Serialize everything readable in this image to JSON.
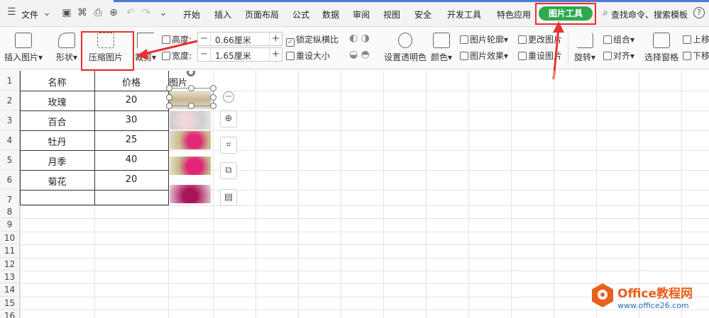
{
  "menu": {
    "label": "文件",
    "items": [
      "开始",
      "插入",
      "页面布局",
      "公式",
      "数据",
      "审阅",
      "视图",
      "安全",
      "开发工具",
      "特色应用"
    ],
    "active": "图片工具",
    "search": "查找命令、搜索模板",
    "help": "?"
  },
  "ribbon": {
    "insert_pic": "插入图片",
    "shape": "形状",
    "compress": "压缩图片",
    "crop": "裁剪",
    "height_label": "高度:",
    "height_value": "0.66厘米",
    "width_label": "宽度:",
    "width_value": "1.65厘米",
    "lock_ratio": "锁定纵横比",
    "reset_size": "重设大小",
    "transparent": "设置透明色",
    "color": "颜色",
    "pic_outline": "图片轮廓",
    "pic_effect": "图片效果",
    "change_pic": "更改图片",
    "reset_pic": "重设图片",
    "rotate": "旋转",
    "group": "组合",
    "align": "对齐",
    "selection": "选择窗格",
    "up": "上移",
    "down": "下移"
  },
  "sheet": {
    "headers": [
      "名称",
      "价格",
      "图片"
    ],
    "rows": [
      {
        "name": "玫瑰",
        "price": "20"
      },
      {
        "name": "百合",
        "price": "30"
      },
      {
        "name": "牡丹",
        "price": "25"
      },
      {
        "name": "月季",
        "price": "40"
      },
      {
        "name": "菊花",
        "price": "20"
      }
    ],
    "row_numbers": [
      "1",
      "2",
      "3",
      "4",
      "5",
      "6",
      "7",
      "8",
      "9",
      "10",
      "11",
      "12",
      "13",
      "14",
      "15",
      "16"
    ]
  },
  "watermark": {
    "brand": "Office教程网",
    "url": "www.office26.com"
  },
  "colors": {
    "accent_green": "#2fa84f",
    "highlight_red": "#e83030",
    "tab_blue": "#4a7bd0"
  }
}
